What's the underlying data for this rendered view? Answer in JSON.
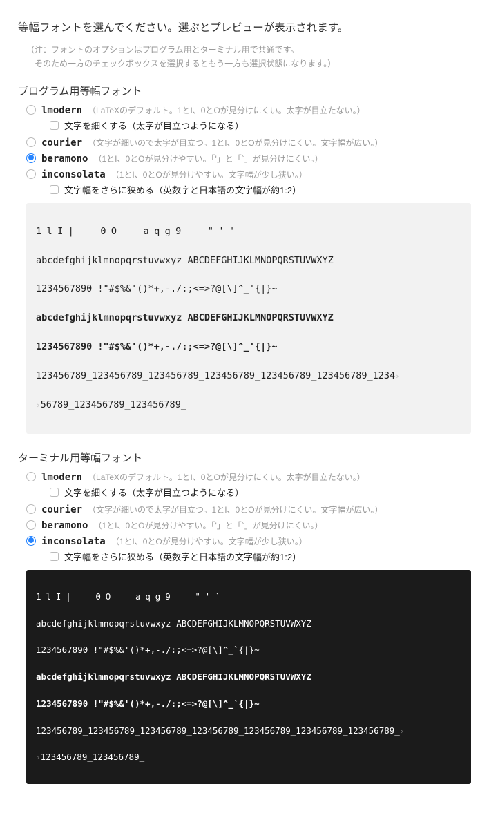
{
  "title": "等幅フォントを選んでください。選ぶとプレビューが表示されます。",
  "note_l1": "（注：フォントのオプションはプログラム用とターミナル用で共通です。",
  "note_l2": "　そのため一方のチェックボックスを選択するともう一方も選択状態になります。）",
  "sections": {
    "program": {
      "heading": "プログラム用等幅フォント",
      "options": [
        {
          "name": "lmodern",
          "desc": "（LaTeXのデフォルト。1とI、0とOが見分けにくい。太字が目立たない。）",
          "selected": false,
          "sub": "文字を細くする（太字が目立つようになる）"
        },
        {
          "name": "courier",
          "desc": "（文字が細いので太字が目立つ。1とI、0とOが見分けにくい。文字幅が広い。）",
          "selected": false
        },
        {
          "name": "beramono",
          "desc": "（1とI、0とOが見分けやすい。「'」と「`」が見分けにくい。）",
          "selected": true
        },
        {
          "name": "inconsolata",
          "desc": "（1とI、0とOが見分けやすい。文字幅が少し狭い。）",
          "selected": false,
          "sub": "文字幅をさらに狭める（英数字と日本語の文字幅が約1:2）"
        }
      ]
    },
    "terminal": {
      "heading": "ターミナル用等幅フォント",
      "options": [
        {
          "name": "lmodern",
          "desc": "（LaTeXのデフォルト。1とI、0とOが見分けにくい。太字が目立たない。）",
          "selected": false,
          "sub": "文字を細くする（太字が目立つようになる）"
        },
        {
          "name": "courier",
          "desc": "（文字が細いので太字が目立つ。1とI、0とOが見分けにくい。文字幅が広い。）",
          "selected": false
        },
        {
          "name": "beramono",
          "desc": "（1とI、0とOが見分けやすい。「'」と「`」が見分けにくい。）",
          "selected": false
        },
        {
          "name": "inconsolata",
          "desc": "（1とI、0とOが見分けやすい。文字幅が少し狭い。）",
          "selected": true,
          "sub": "文字幅をさらに狭める（英数字と日本語の文字幅が約1:2）"
        }
      ]
    }
  },
  "preview_light": {
    "l1": "1lI|  0O  aqg9  \"''",
    "l2": "abcdefghijklmnopqrstuvwxyz ABCDEFGHIJKLMNOPQRSTUVWXYZ",
    "l3": "1234567890 !\"#$%&'()*+,-./:;<=>?@[\\]^_'{|}~",
    "l4": "abcdefghijklmnopqrstuvwxyz ABCDEFGHIJKLMNOPQRSTUVWXYZ",
    "l5": "1234567890 !\"#$%&'()*+,-./:;<=>?@[\\]^_'{|}~",
    "l6a": "123456789_123456789_123456789_123456789_123456789_123456789_1234",
    "wrap1": "›",
    "wrap2": "›",
    "l6b": "56789_123456789_123456789_"
  },
  "preview_dark": {
    "l1": "1lI|  0O  aqg9  \"'`",
    "l2": "abcdefghijklmnopqrstuvwxyz ABCDEFGHIJKLMNOPQRSTUVWXYZ",
    "l3": "1234567890 !\"#$%&'()*+,-./:;<=>?@[\\]^_`{|}~",
    "l4": "abcdefghijklmnopqrstuvwxyz ABCDEFGHIJKLMNOPQRSTUVWXYZ",
    "l5": "1234567890 !\"#$%&'()*+,-./:;<=>?@[\\]^_`{|}~",
    "l6a": "123456789_123456789_123456789_123456789_123456789_123456789_123456789_",
    "wrap1": "›",
    "wrap2": "›",
    "l6b": "123456789_123456789_"
  }
}
